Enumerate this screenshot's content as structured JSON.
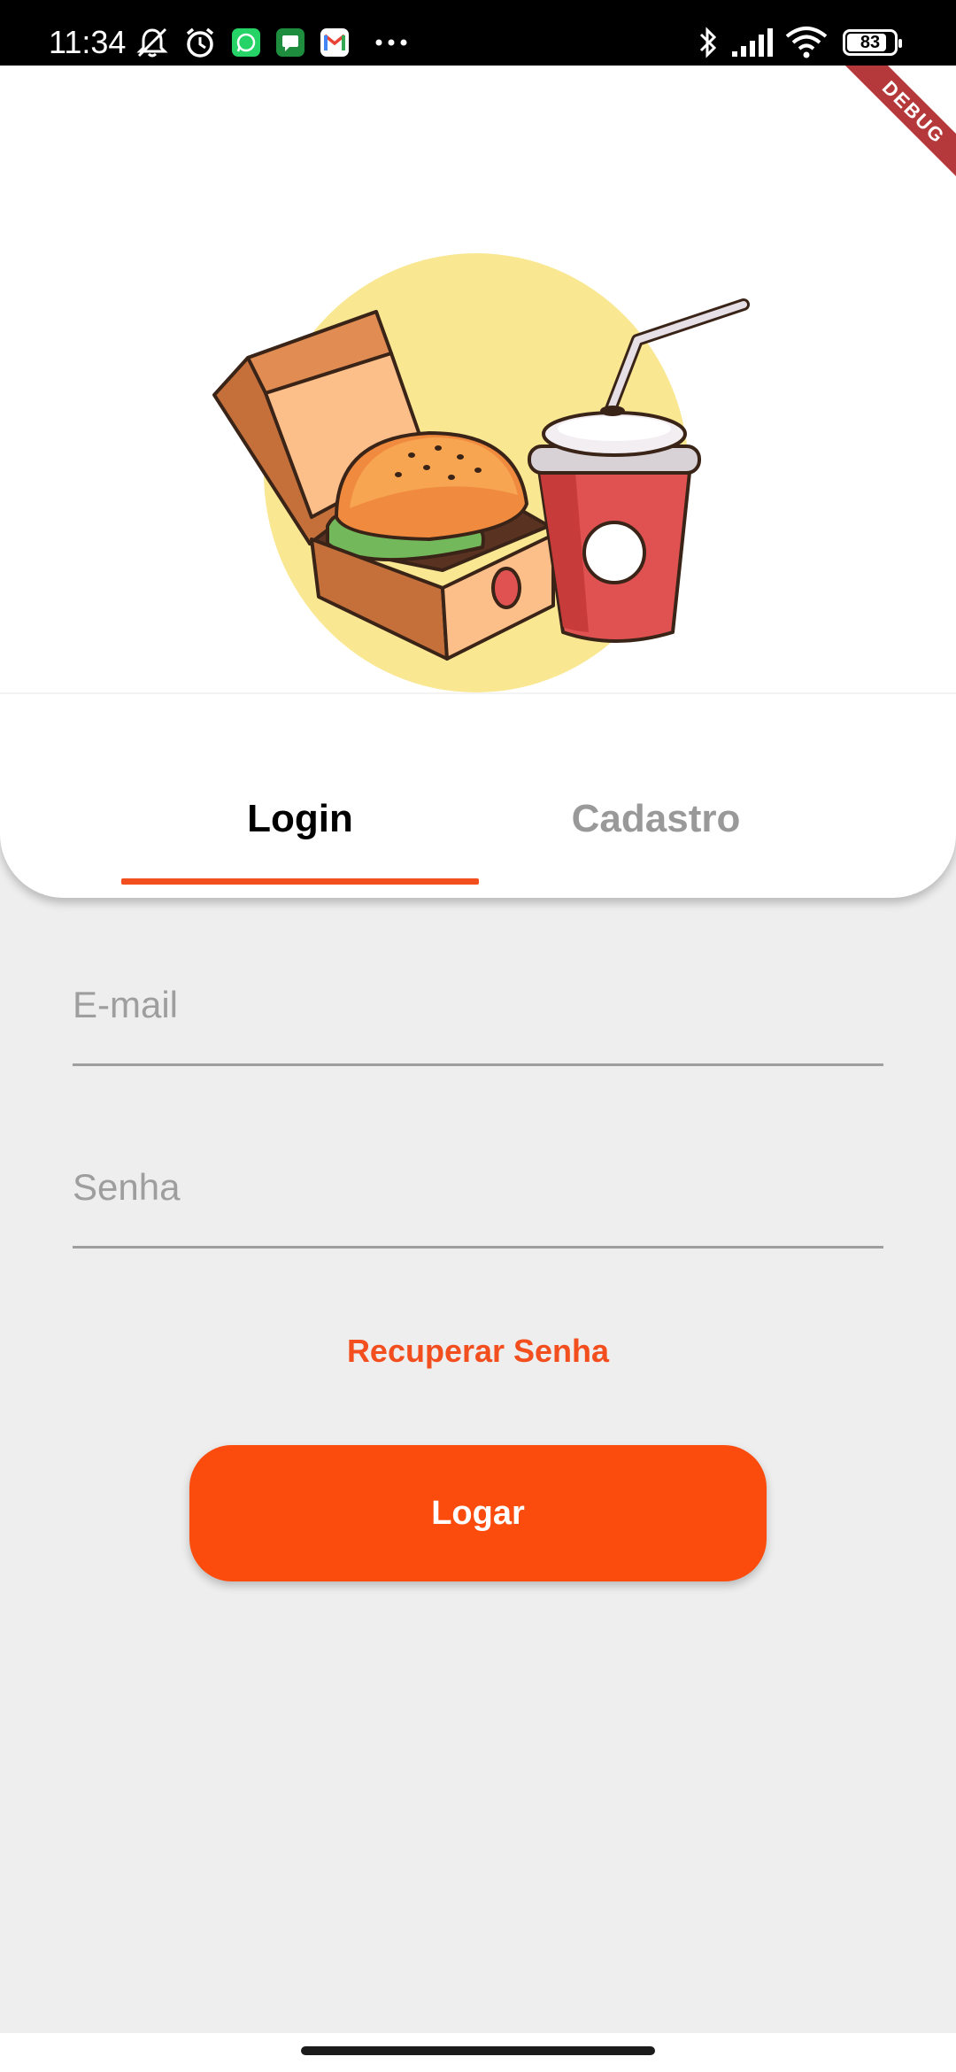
{
  "status_bar": {
    "time": "11:34",
    "battery": "83",
    "icons": [
      "mute-icon",
      "alarm-icon",
      "whatsapp-icon",
      "messages-icon",
      "gmail-icon",
      "more-icon",
      "bluetooth-icon",
      "signal-icon",
      "wifi-icon",
      "battery-icon"
    ]
  },
  "debug_banner": "DEBUG",
  "illustration": "burger-box-and-soda-illustration",
  "tabs": [
    {
      "label": "Login",
      "selected": true
    },
    {
      "label": "Cadastro",
      "selected": false
    }
  ],
  "form": {
    "email_placeholder": "E-mail",
    "email_value": "",
    "password_placeholder": "Senha",
    "password_value": ""
  },
  "recover_password_label": "Recuperar Senha",
  "login_button_label": "Logar",
  "colors": {
    "accent": "#f24e1e",
    "button": "#fb4c0d",
    "background": "#eeeeee",
    "sun_circle": "#f9e792",
    "cup_red": "#e05252"
  }
}
